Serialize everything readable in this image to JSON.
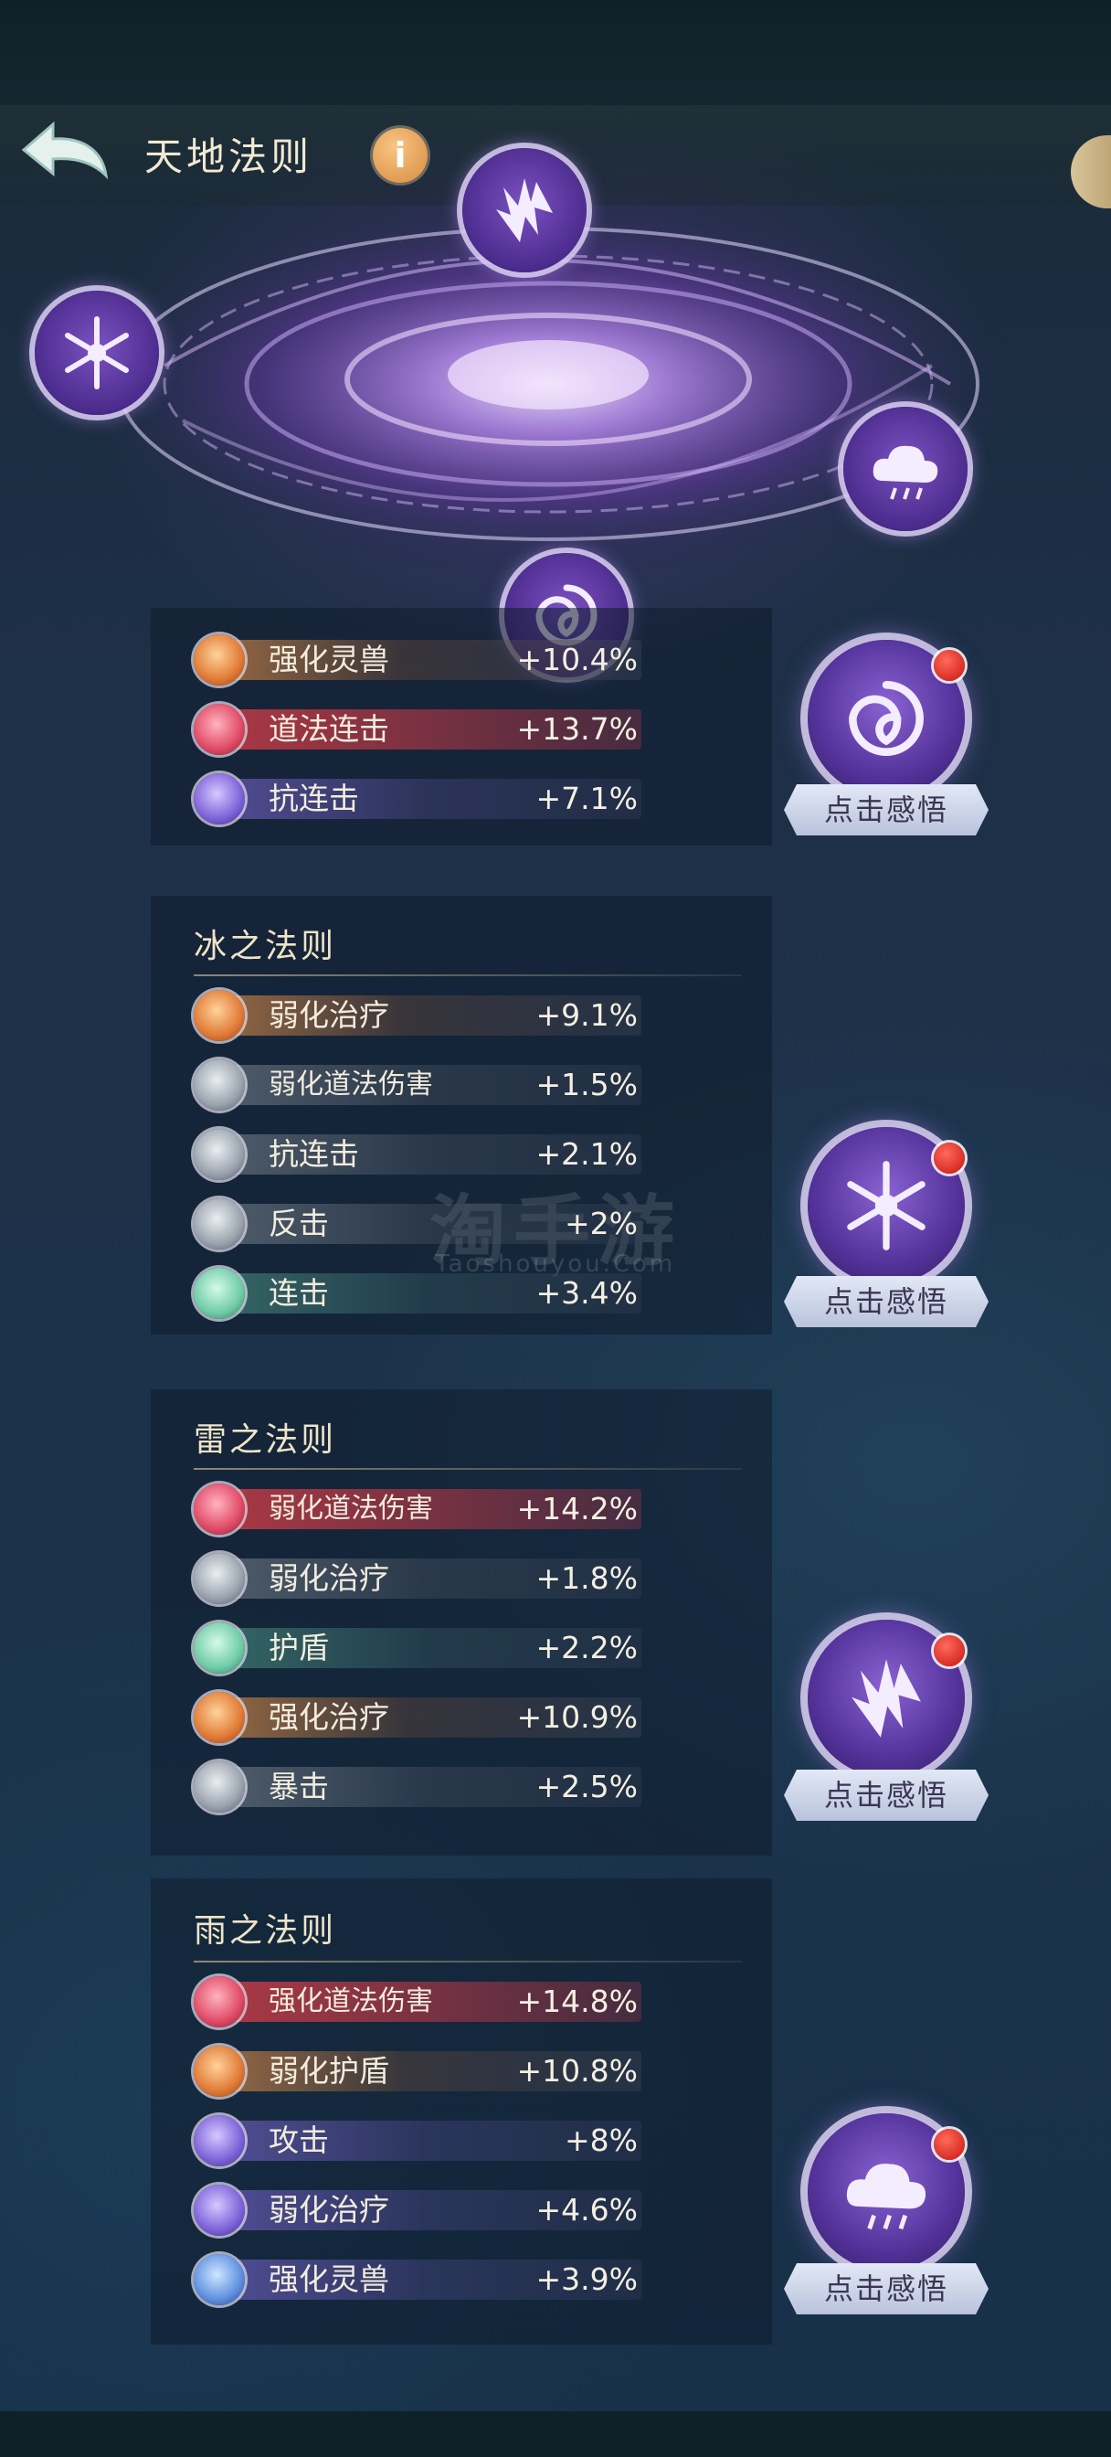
{
  "header": {
    "title": "天地法则",
    "info_label": "i"
  },
  "watermark": {
    "main": "淘手游",
    "sub": "Taoshouyou.Com"
  },
  "perceive_label": "点击感悟",
  "sections": [
    {
      "title": "",
      "orb_icon": "wind-swirl-icon",
      "attrs": [
        {
          "name": "强化灵兽",
          "value": "+10.4%",
          "color": "orange"
        },
        {
          "name": "道法连击",
          "value": "+13.7%",
          "color": "red"
        },
        {
          "name": "抗连击",
          "value": "+7.1%",
          "color": "purple"
        }
      ]
    },
    {
      "title": "冰之法则",
      "orb_icon": "snowflake-icon",
      "attrs": [
        {
          "name": "弱化治疗",
          "value": "+9.1%",
          "color": "orange"
        },
        {
          "name": "弱化道法伤害",
          "value": "+1.5%",
          "color": "grey"
        },
        {
          "name": "抗连击",
          "value": "+2.1%",
          "color": "grey"
        },
        {
          "name": "反击",
          "value": "+2%",
          "color": "grey"
        },
        {
          "name": "连击",
          "value": "+3.4%",
          "color": "green"
        }
      ]
    },
    {
      "title": "雷之法则",
      "orb_icon": "lightning-icon",
      "attrs": [
        {
          "name": "弱化道法伤害",
          "value": "+14.2%",
          "color": "red"
        },
        {
          "name": "弱化治疗",
          "value": "+1.8%",
          "color": "grey"
        },
        {
          "name": "护盾",
          "value": "+2.2%",
          "color": "green"
        },
        {
          "name": "强化治疗",
          "value": "+10.9%",
          "color": "orange"
        },
        {
          "name": "暴击",
          "value": "+2.5%",
          "color": "grey"
        }
      ]
    },
    {
      "title": "雨之法则",
      "orb_icon": "rain-cloud-icon",
      "attrs": [
        {
          "name": "强化道法伤害",
          "value": "+14.8%",
          "color": "red"
        },
        {
          "name": "弱化护盾",
          "value": "+10.8%",
          "color": "orange"
        },
        {
          "name": "攻击",
          "value": "+8%",
          "color": "purple"
        },
        {
          "name": "弱化治疗",
          "value": "+4.6%",
          "color": "purple"
        },
        {
          "name": "强化灵兽",
          "value": "+3.9%",
          "color": "blue"
        }
      ]
    }
  ]
}
